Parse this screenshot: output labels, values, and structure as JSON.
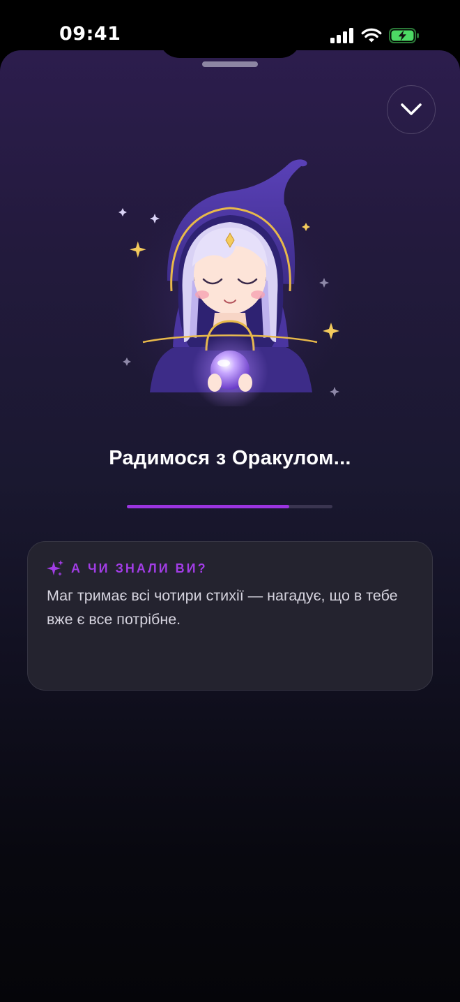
{
  "status_bar": {
    "time": "09:41",
    "icons": [
      "cellular-signal-icon",
      "wifi-icon",
      "battery-charging-icon"
    ]
  },
  "sheet": {
    "collapse_icon": "chevron-down-icon",
    "illustration": "oracle-wizard-illustration",
    "title": "Радимося з Оракулом...",
    "progress": 0.79,
    "fact_card": {
      "icon": "sparkles-icon",
      "label": "А ЧИ ЗНАЛИ ВИ?",
      "text": "Маг тримає всі чотири стихії — нагадує, що в тебе вже є все потрібне."
    }
  },
  "colors": {
    "accent": "#9b34e0",
    "label": "#a23de6",
    "battery": "#4cd964"
  }
}
